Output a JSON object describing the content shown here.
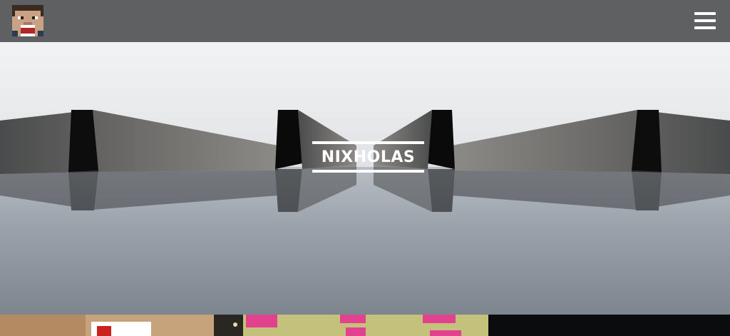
{
  "header": {
    "avatar_icon": "pixel-face-avatar-icon",
    "menu_icon": "hamburger-menu-icon"
  },
  "hero": {
    "title": "NIXHOLAS",
    "background": "mirrored-concrete-walls-photo"
  },
  "thumbnails": [
    {
      "name": "thumbnail-1",
      "description_icon": "photo-thumbnail-red-sign"
    },
    {
      "name": "thumbnail-2",
      "description_icon": "photo-thumbnail-sticky-notes"
    },
    {
      "name": "thumbnail-3",
      "description_icon": "photo-thumbnail-dark"
    }
  ],
  "colors": {
    "header_bg": "#5f6062",
    "title_color": "#ffffff",
    "sky": "#eceef0"
  }
}
